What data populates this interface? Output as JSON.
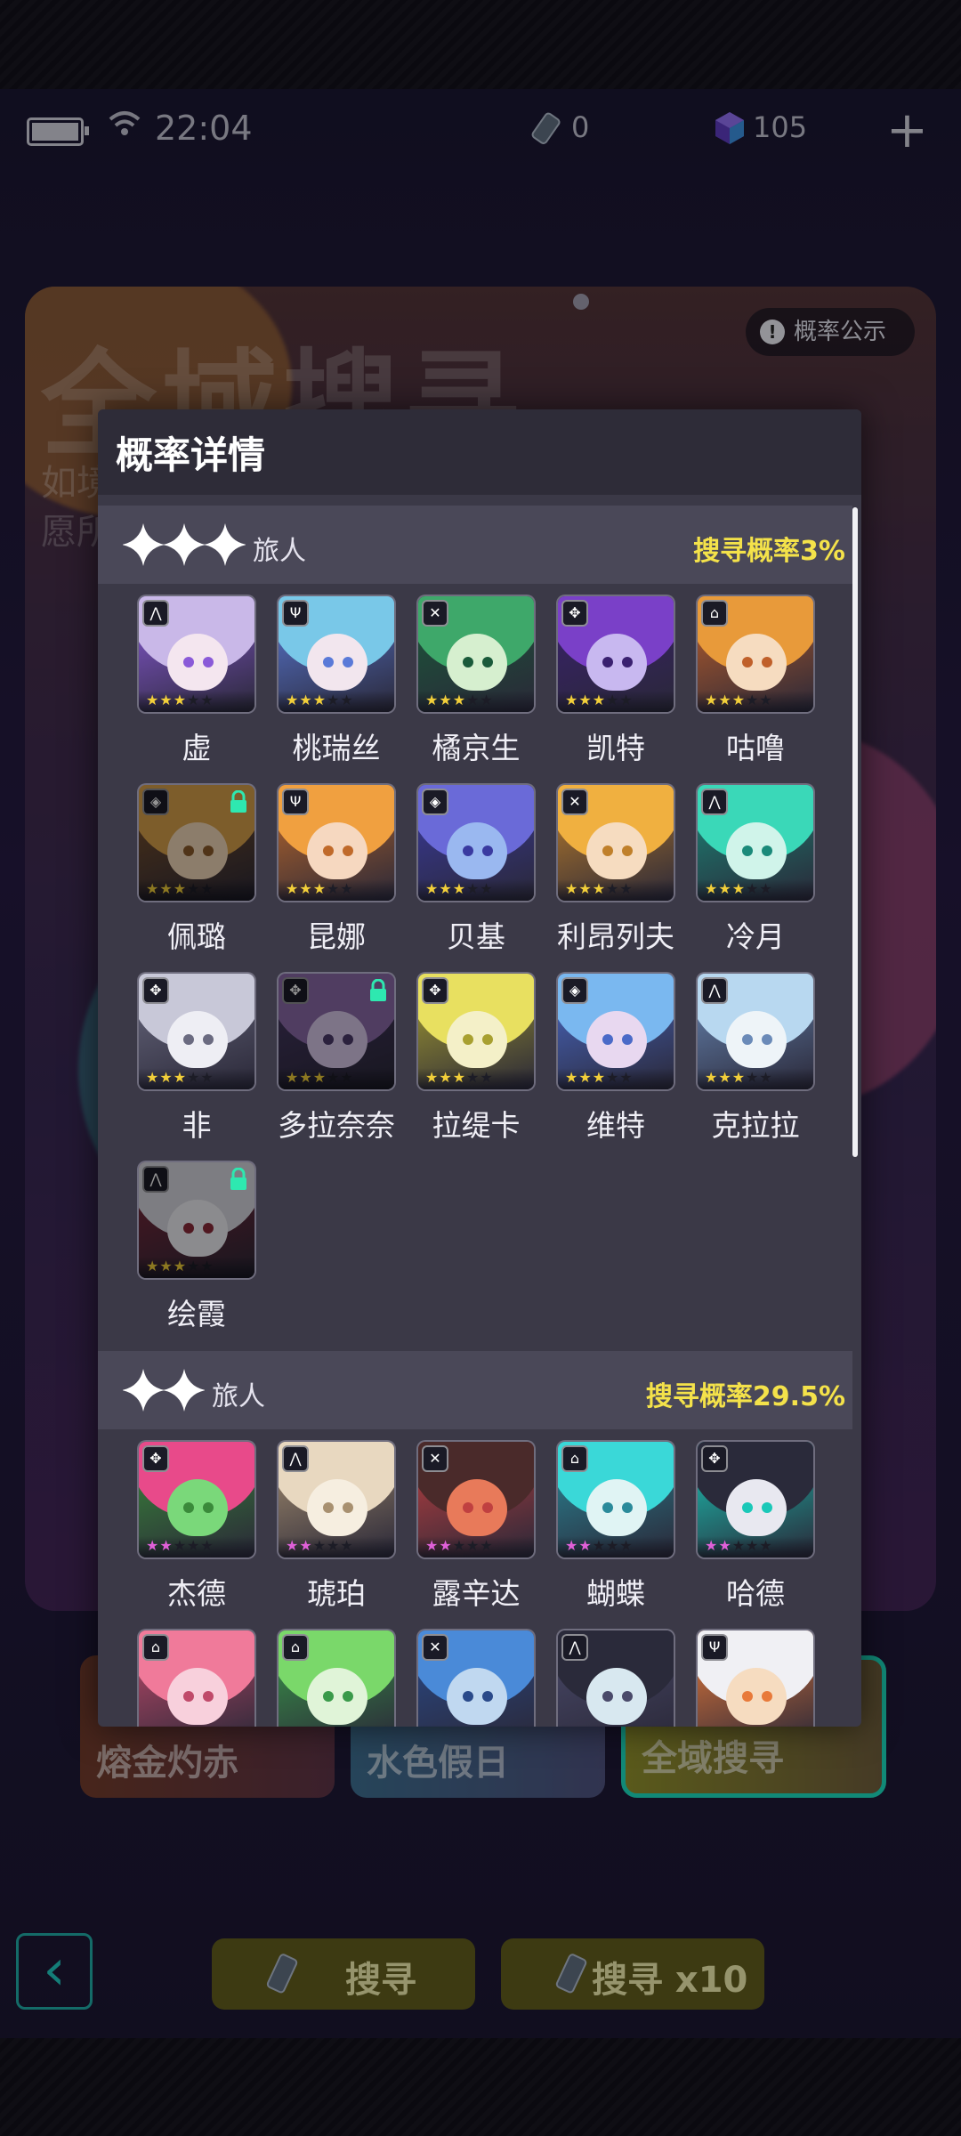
{
  "status_bar": {
    "time": "22:04",
    "tickets": "0",
    "gems": "105"
  },
  "background": {
    "banner_title": "全域搜寻",
    "banner_sub1": "如境",
    "banner_sub2": "愿所",
    "prob_button": "概率公示",
    "tabs": [
      {
        "label": "熔金灼赤"
      },
      {
        "label": "水色假日"
      },
      {
        "label": "全域搜寻"
      }
    ],
    "search_once": {
      "label": "搜寻",
      "count": "1"
    },
    "search_ten": {
      "label": "搜寻 x10",
      "count": "10"
    }
  },
  "modal": {
    "title": "概率详情",
    "sections": [
      {
        "stars": 3,
        "label": "旅人",
        "rate": "搜寻概率3%",
        "characters": [
          {
            "name": "虚",
            "colors": [
              "#c9b8e8",
              "#f4e6ef",
              "#8a5ad8"
            ],
            "locked": false,
            "cls": "⋀"
          },
          {
            "name": "桃瑞丝",
            "colors": [
              "#79c8e8",
              "#f2e6ee",
              "#5a7ad8"
            ],
            "locked": false,
            "cls": "Ψ"
          },
          {
            "name": "橘京生",
            "colors": [
              "#3ea86a",
              "#d6efcf",
              "#1a5a3a"
            ],
            "locked": false,
            "cls": "✕"
          },
          {
            "name": "凯特",
            "colors": [
              "#7a40c8",
              "#c8b8f0",
              "#3a2070"
            ],
            "locked": false,
            "cls": "✥"
          },
          {
            "name": "咕噜",
            "colors": [
              "#e89a3a",
              "#f6dcc0",
              "#c0602a"
            ],
            "locked": false,
            "cls": "⌂"
          },
          {
            "name": "佩璐",
            "colors": [
              "#d8a04a",
              "#f2d8b8",
              "#8a5a2a"
            ],
            "locked": true,
            "cls": "◈"
          },
          {
            "name": "昆娜",
            "colors": [
              "#f0a040",
              "#f6d8c0",
              "#c06a2a"
            ],
            "locked": false,
            "cls": "Ψ"
          },
          {
            "name": "贝基",
            "colors": [
              "#6a6ad8",
              "#9ab8f0",
              "#3a3aa0"
            ],
            "locked": false,
            "cls": "◈"
          },
          {
            "name": "利昂列夫",
            "colors": [
              "#f0b040",
              "#f6dcc0",
              "#c0802a"
            ],
            "locked": false,
            "cls": "✕"
          },
          {
            "name": "冷月",
            "colors": [
              "#3ad8b8",
              "#d0f4ea",
              "#1a8a7a"
            ],
            "locked": false,
            "cls": "⋀"
          },
          {
            "name": "非",
            "colors": [
              "#c8c8d8",
              "#eeeef4",
              "#6a6a80"
            ],
            "locked": false,
            "cls": "✥"
          },
          {
            "name": "多拉奈奈",
            "colors": [
              "#8a6aa8",
              "#d8c8e8",
              "#4a3a6a"
            ],
            "locked": true,
            "cls": "✥"
          },
          {
            "name": "拉缇卡",
            "colors": [
              "#e8e060",
              "#f4f0c8",
              "#a8a030"
            ],
            "locked": false,
            "cls": "✥"
          },
          {
            "name": "维特",
            "colors": [
              "#7ab8f0",
              "#e8d8f0",
              "#4a6ac8"
            ],
            "locked": false,
            "cls": "◈"
          },
          {
            "name": "克拉拉",
            "colors": [
              "#b8d8f0",
              "#eef4f8",
              "#6a8ab8"
            ],
            "locked": false,
            "cls": "⋀"
          },
          {
            "name": "绘霞",
            "colors": [
              "#d8d8e0",
              "#f0f0f4",
              "#8a2a3a"
            ],
            "locked": true,
            "cls": "⋀"
          }
        ]
      },
      {
        "stars": 2,
        "label": "旅人",
        "rate": "搜寻概率29.5%",
        "characters": [
          {
            "name": "杰德",
            "colors": [
              "#e84a8a",
              "#7ad87a",
              "#3a8a3a"
            ],
            "locked": false,
            "cls": "✥"
          },
          {
            "name": "琥珀",
            "colors": [
              "#e8d8c0",
              "#f6eee0",
              "#a89070"
            ],
            "locked": false,
            "cls": "⋀"
          },
          {
            "name": "露辛达",
            "colors": [
              "#4a2a2a",
              "#e87a5a",
              "#c04040"
            ],
            "locked": false,
            "cls": "✕"
          },
          {
            "name": "蝴蝶",
            "colors": [
              "#3ad8d8",
              "#e0f4f4",
              "#2a8a9a"
            ],
            "locked": false,
            "cls": "⌂"
          },
          {
            "name": "哈德",
            "colors": [
              "#2a2a3a",
              "#e8e8f0",
              "#1ac8b8"
            ],
            "locked": false,
            "cls": "✥"
          },
          {
            "name": "",
            "colors": [
              "#f07a9a",
              "#f8d0dc",
              "#c04a6a"
            ],
            "locked": false,
            "cls": "⌂"
          },
          {
            "name": "",
            "colors": [
              "#7ad86a",
              "#e0f4d8",
              "#3a9a4a"
            ],
            "locked": false,
            "cls": "⌂"
          },
          {
            "name": "",
            "colors": [
              "#4a8ad8",
              "#c0d8f0",
              "#2a4a8a"
            ],
            "locked": false,
            "cls": "✕"
          },
          {
            "name": "",
            "colors": [
              "#2a2a3a",
              "#d8e8f0",
              "#4a4a6a"
            ],
            "locked": false,
            "cls": "⋀"
          },
          {
            "name": "",
            "colors": [
              "#f0f0f4",
              "#f6dcc0",
              "#e87a3a"
            ],
            "locked": false,
            "cls": "Ψ"
          }
        ]
      }
    ]
  }
}
